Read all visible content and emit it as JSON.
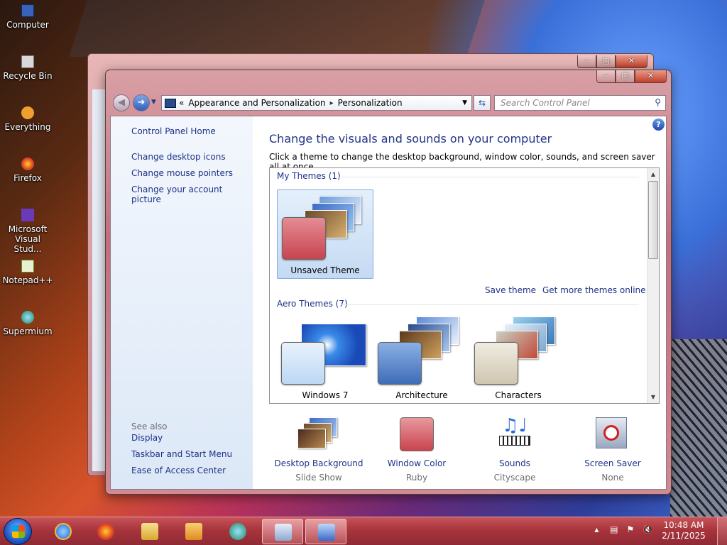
{
  "desktop": {
    "icons": [
      {
        "label": "Computer",
        "icon": "computer-icon"
      },
      {
        "label": "Recycle Bin",
        "icon": "recycle-bin-icon"
      },
      {
        "label": "Everything",
        "icon": "everything-icon"
      },
      {
        "label": "Firefox",
        "icon": "firefox-icon"
      },
      {
        "label": "Microsoft Visual Stud...",
        "icon": "visual-studio-icon"
      },
      {
        "label": "Notepad++",
        "icon": "notepadpp-icon"
      },
      {
        "label": "Supermium",
        "icon": "supermium-icon"
      }
    ]
  },
  "window": {
    "controls": {
      "minimize": "‒",
      "maximize": "□",
      "close": "✕"
    },
    "address": {
      "root_chevrons": "«",
      "crumbs": [
        "Appearance and Personalization",
        "Personalization"
      ],
      "sep": "▸"
    },
    "search": {
      "placeholder": "Search Control Panel"
    }
  },
  "sidebar": {
    "home": "Control Panel Home",
    "links": [
      "Change desktop icons",
      "Change mouse pointers",
      "Change your account picture"
    ],
    "see_also_label": "See also",
    "see_also": [
      "Display",
      "Taskbar and Start Menu",
      "Ease of Access Center"
    ]
  },
  "main": {
    "title": "Change the visuals and sounds on your computer",
    "description": "Click a theme to change the desktop background, window color, sounds, and screen saver all at once.",
    "help": "?",
    "my_themes_header": "My Themes (1)",
    "my_themes": [
      {
        "label": "Unsaved Theme",
        "selected": true,
        "color": "#d8707a"
      }
    ],
    "save_theme": "Save theme",
    "get_more": "Get more themes online",
    "aero_header": "Aero Themes (7)",
    "aero_themes": [
      {
        "label": "Windows 7",
        "color": "#cfe2f7"
      },
      {
        "label": "Architecture",
        "color": "#6a8ec8"
      },
      {
        "label": "Characters",
        "color": "#d8d0c0"
      }
    ]
  },
  "bottom": [
    {
      "title": "Desktop Background",
      "sub": "Slide Show",
      "icon": "desktop-background-icon"
    },
    {
      "title": "Window Color",
      "sub": "Ruby",
      "icon": "window-color-icon",
      "color": "#d8686e"
    },
    {
      "title": "Sounds",
      "sub": "Cityscape",
      "icon": "sounds-icon"
    },
    {
      "title": "Screen Saver",
      "sub": "None",
      "icon": "screen-saver-icon"
    }
  ],
  "taskbar": {
    "apps": [
      "internet-explorer-icon",
      "firefox-icon",
      "file-explorer-icon",
      "media-player-icon",
      "supermium-icon",
      "window-app-icon",
      "control-panel-icon"
    ],
    "time": "10:48 AM",
    "date": "2/11/2025",
    "tray_up": "▴"
  }
}
